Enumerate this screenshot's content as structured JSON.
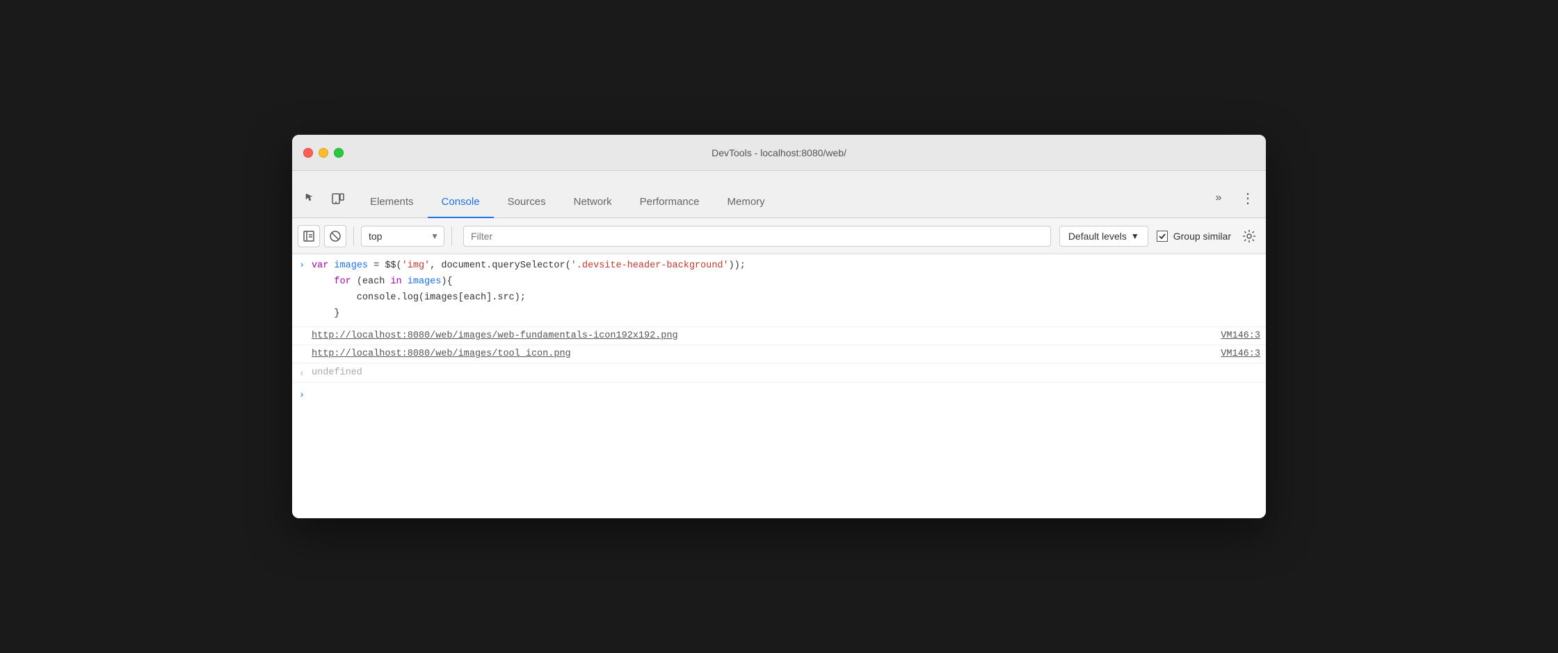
{
  "window": {
    "title": "DevTools - localhost:8080/web/"
  },
  "tabs": {
    "items": [
      {
        "id": "elements",
        "label": "Elements",
        "active": false
      },
      {
        "id": "console",
        "label": "Console",
        "active": true
      },
      {
        "id": "sources",
        "label": "Sources",
        "active": false
      },
      {
        "id": "network",
        "label": "Network",
        "active": false
      },
      {
        "id": "performance",
        "label": "Performance",
        "active": false
      },
      {
        "id": "memory",
        "label": "Memory",
        "active": false
      }
    ]
  },
  "toolbar": {
    "context_value": "top",
    "filter_placeholder": "Filter",
    "levels_label": "Default levels",
    "group_similar_label": "Group similar"
  },
  "console": {
    "code_line1": "var ",
    "code_var_images": "images",
    "code_line1b": " = $$(&#39;",
    "code_str_img": "img",
    "code_line1c": "&#39;, document.querySelector(&#39;",
    "code_str_selector": ".devsite-header-background",
    "code_line1d": "&#39;));",
    "code_line2": "for (each in images){",
    "code_line3": "    console.log(images[each].src);",
    "code_line4": "}",
    "link1": "http://localhost:8080/web/images/web-fundamentals-icon192x192.png",
    "link1_ref": "VM146:3",
    "link2": "http://localhost:8080/web/images/tool_icon.png",
    "link2_ref": "VM146:3",
    "undefined_text": "undefined"
  }
}
